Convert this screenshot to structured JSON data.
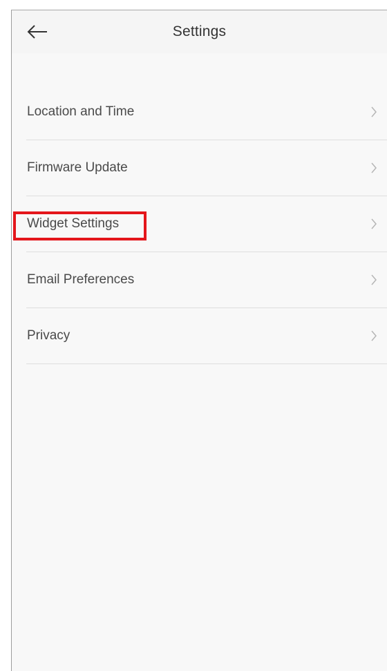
{
  "header": {
    "title": "Settings",
    "back_icon": "arrow-left-icon"
  },
  "settings": {
    "items": [
      {
        "label": "Location and Time",
        "icon": "chevron-right-icon"
      },
      {
        "label": "Firmware Update",
        "icon": "chevron-right-icon"
      },
      {
        "label": "Widget Settings",
        "icon": "chevron-right-icon"
      },
      {
        "label": "Email Preferences",
        "icon": "chevron-right-icon"
      },
      {
        "label": "Privacy",
        "icon": "chevron-right-icon"
      }
    ]
  },
  "annotation": {
    "highlight_color": "#e4161b",
    "highlighted_item": "Widget Settings"
  },
  "colors": {
    "background": "#f8f8f8",
    "text": "#4a4a4a",
    "divider": "#dedede"
  }
}
